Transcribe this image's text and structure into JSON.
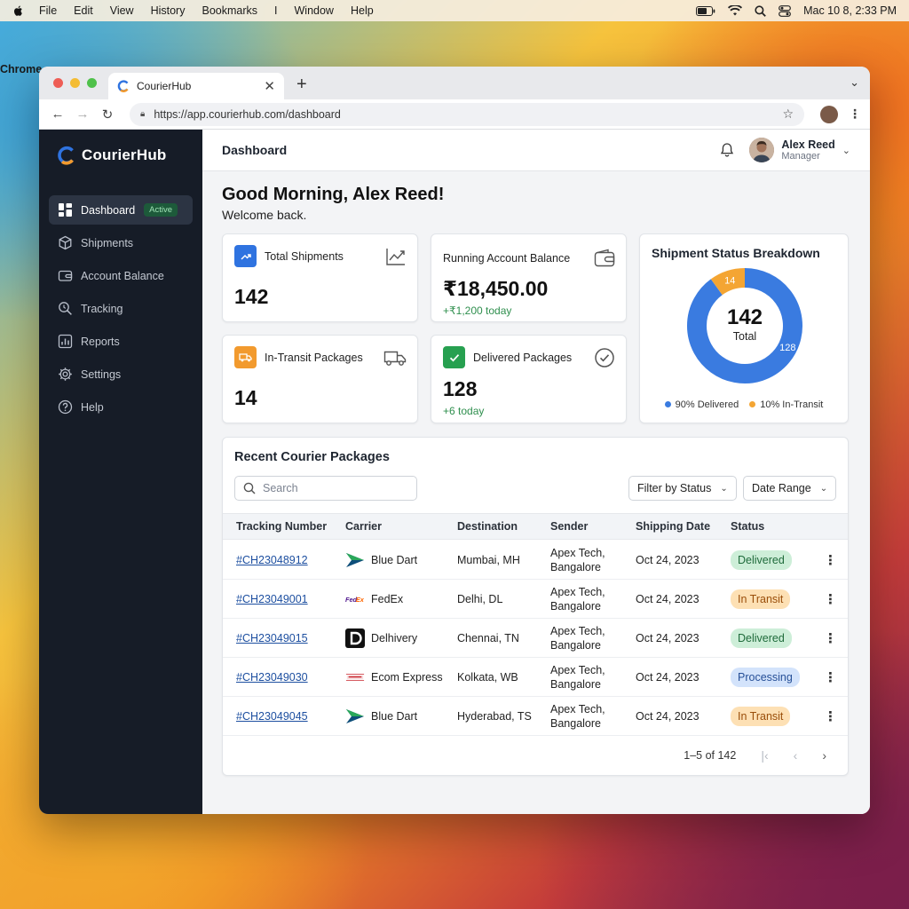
{
  "menubar": {
    "app": "Chrome",
    "items": [
      "File",
      "Edit",
      "View",
      "History",
      "Bookmarks",
      "I",
      "Window",
      "Help"
    ],
    "clock": "Mac 10 8,  2:33 PM"
  },
  "browser": {
    "tab_title": "CourierHub",
    "url": "https://app.courierhub.com/dashboard"
  },
  "sidebar": {
    "brand": "CourierHub",
    "items": [
      {
        "label": "Dashboard",
        "badge": "Active"
      },
      {
        "label": "Shipments"
      },
      {
        "label": "Account Balance"
      },
      {
        "label": "Tracking"
      },
      {
        "label": "Reports"
      },
      {
        "label": "Settings"
      },
      {
        "label": "Help"
      }
    ]
  },
  "header": {
    "title": "Dashboard",
    "user_name": "Alex Reed",
    "user_role": "Manager"
  },
  "greeting": {
    "title": "Good Morning, Alex Reed!",
    "subtitle": "Welcome back."
  },
  "stats": {
    "total_shipments": {
      "label": "Total Shipments",
      "value": "142"
    },
    "balance": {
      "label": "Running Account Balance",
      "value": "₹18,450.00",
      "sub": "+₹1,200 today"
    },
    "in_transit": {
      "label": "In-Transit Packages",
      "value": "14"
    },
    "delivered": {
      "label": "Delivered Packages",
      "value": "128",
      "sub": "+6 today"
    }
  },
  "breakdown": {
    "title": "Shipment Status Breakdown",
    "center_value": "142",
    "center_label": "Total",
    "delivered_count": "128",
    "transit_count": "14",
    "delivered_fraction": 0.9,
    "legend_delivered": "90% Delivered",
    "legend_transit": "10% In-Transit",
    "colors": {
      "delivered": "#3a7be0",
      "transit": "#f4a533"
    }
  },
  "recent": {
    "title": "Recent Courier Packages",
    "search_placeholder": "Search",
    "filter_label": "Filter by Status",
    "date_label": "Date Range",
    "columns": [
      "Tracking Number",
      "Carrier",
      "Destination",
      "Sender",
      "Shipping Date",
      "Status"
    ],
    "rows": [
      {
        "tracking": "#CH23048912",
        "carrier": "Blue Dart",
        "destination": "Mumbai, MH",
        "sender_1": "Apex Tech,",
        "sender_2": "Bangalore",
        "date": "Oct 24, 2023",
        "status": "Delivered"
      },
      {
        "tracking": "#CH23049001",
        "carrier": "FedEx",
        "destination": "Delhi, DL",
        "sender_1": "Apex Tech,",
        "sender_2": "Bangalore",
        "date": "Oct 24, 2023",
        "status": "In Transit"
      },
      {
        "tracking": "#CH23049015",
        "carrier": "Delhivery",
        "destination": "Chennai, TN",
        "sender_1": "Apex Tech,",
        "sender_2": "Bangalore",
        "date": "Oct 24, 2023",
        "status": "Delivered"
      },
      {
        "tracking": "#CH23049030",
        "carrier": "Ecom Express",
        "destination": "Kolkata, WB",
        "sender_1": "Apex Tech,",
        "sender_2": "Bangalore",
        "date": "Oct 24, 2023",
        "status": "Processing"
      },
      {
        "tracking": "#CH23049045",
        "carrier": "Blue Dart",
        "destination": "Hyderabad, TS",
        "sender_1": "Apex Tech,",
        "sender_2": "Bangalore",
        "date": "Oct 24, 2023",
        "status": "In Transit"
      }
    ],
    "pagination": "1–5 of 142"
  }
}
